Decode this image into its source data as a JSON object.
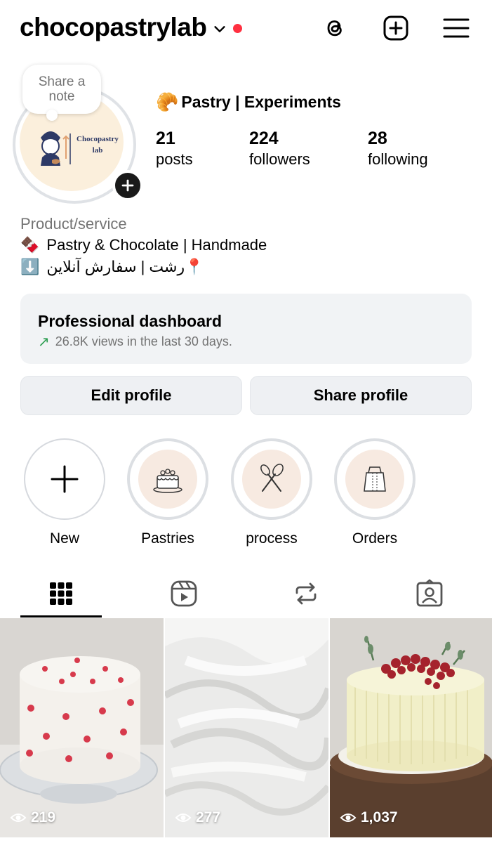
{
  "header": {
    "username": "chocopastrylab",
    "icons": [
      "threads-icon",
      "create-post-icon",
      "menu-icon"
    ]
  },
  "profile": {
    "note_text": "Share a note",
    "avatar_text": "Chocopastry lab",
    "display_name_emoji": "🥐",
    "display_name": "Pastry | Experiments",
    "stats": [
      {
        "value": "21",
        "label": "posts"
      },
      {
        "value": "224",
        "label": "followers"
      },
      {
        "value": "28",
        "label": "following"
      }
    ],
    "category": "Product/service",
    "bio": [
      {
        "emoji": "🍫",
        "text": "Pastry & Chocolate | Handmade"
      },
      {
        "emoji": "⬇️",
        "text": "رشت | سفارش آنلاین📍"
      }
    ]
  },
  "dashboard": {
    "title": "Professional dashboard",
    "subtitle": "26.8K views in the last 30 days."
  },
  "buttons": {
    "edit": "Edit profile",
    "share": "Share profile"
  },
  "highlights": [
    {
      "label": "New"
    },
    {
      "label": "Pastries"
    },
    {
      "label": "process"
    },
    {
      "label": "Orders"
    }
  ],
  "tabs": [
    "grid-icon",
    "reels-icon",
    "reposts-icon",
    "tagged-icon"
  ],
  "posts": [
    {
      "views": "219"
    },
    {
      "views": "277"
    },
    {
      "views": "1,037"
    }
  ],
  "colors": {
    "accent_red": "#ff3040",
    "trend_green": "#2e9e52",
    "muted_text": "#737373",
    "card_bg": "#f1f3f5"
  }
}
